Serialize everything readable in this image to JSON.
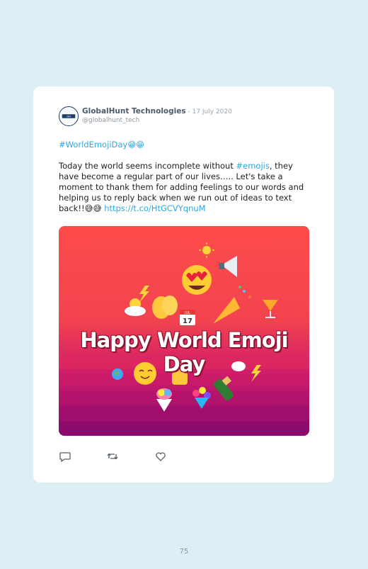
{
  "tweet": {
    "author_name": "GlobalHunt Technologies",
    "date": " - 17 July 2020",
    "handle": "@globalhunt_tech",
    "hashtag": "#WorldEmojiDay😁😁",
    "text_part1": "Today the world seems incomplete without ",
    "emojis_tag": "#emojis",
    "text_part2": ", they have become a regular part of our lives….. Let's take a moment to thank them for adding feelings to our words and helping us to reply back when we run out of ideas to text back!!😅😅 ",
    "link": "https://t.co/HtGCVYqnuM"
  },
  "banner": {
    "title": "Happy World Emoji Day",
    "calendar_month": "JUL",
    "calendar_day": "17",
    "colors": [
      "#fe4c4a",
      "#d01c6a",
      "#8b0a6e"
    ]
  },
  "actions": {
    "icons": [
      "reply-icon",
      "retweet-icon",
      "like-icon"
    ]
  },
  "page_number": "75"
}
